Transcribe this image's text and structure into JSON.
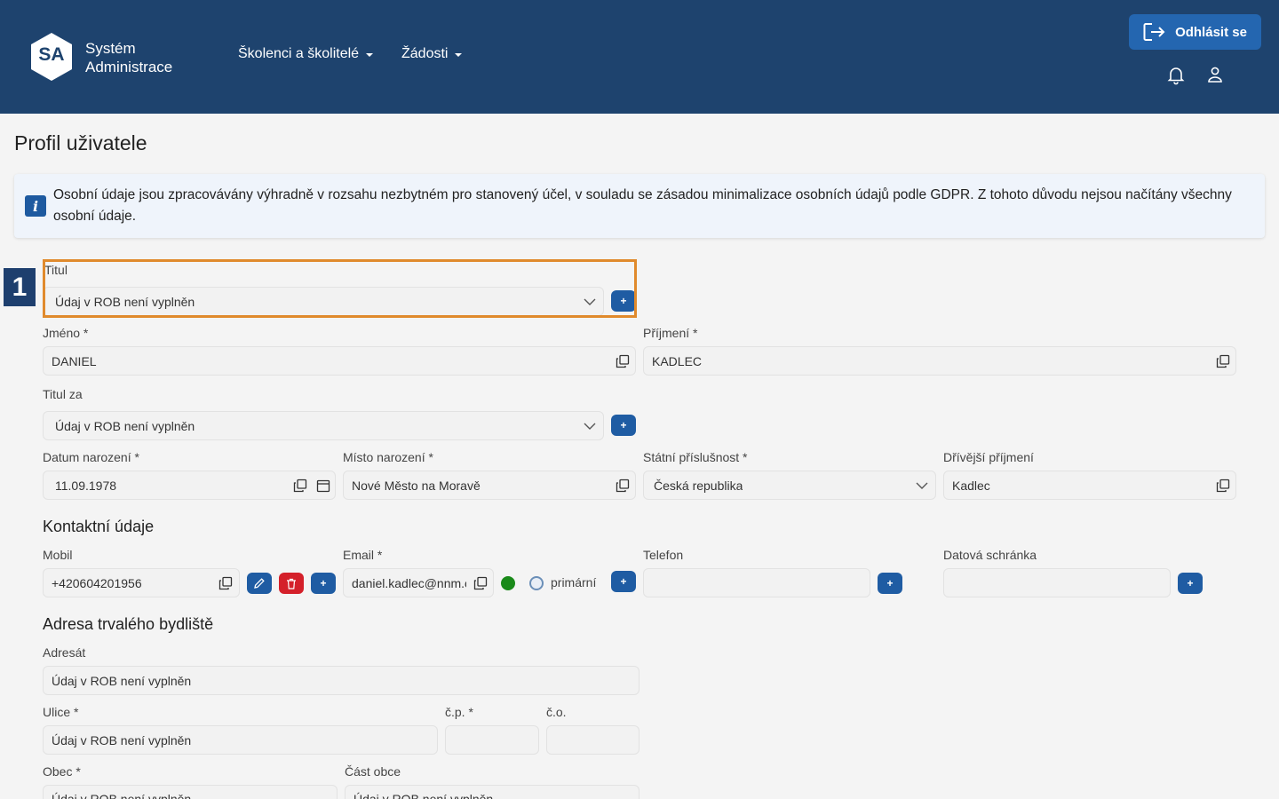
{
  "header": {
    "logo_abbr": "SA",
    "logo_line1": "Systém",
    "logo_line2": "Administrace",
    "nav": [
      {
        "label": "Školenci a školitelé"
      },
      {
        "label": "Žádosti"
      }
    ],
    "logout_label": "Odhlásit se"
  },
  "page": {
    "title": "Profil uživatele",
    "info_text": "Osobní údaje jsou zpracovávány výhradně v rozsahu nezbytném pro stanovený účel, v souladu se zásadou minimalizace osobních údajů podle GDPR. Z tohoto důvodu nejsou načítány všechny osobní údaje.",
    "info_icon": "i",
    "step_badge": "1"
  },
  "personal": {
    "titul_label": "Titul",
    "titul_value": "Údaj v ROB není vyplněn",
    "jmeno_label": "Jméno *",
    "jmeno_value": "DANIEL",
    "prijmeni_label": "Příjmení *",
    "prijmeni_value": "KADLEC",
    "titul_za_label": "Titul za",
    "titul_za_value": "Údaj v ROB není vyplněn",
    "datum_label": "Datum narození *",
    "datum_value": "11.09.1978",
    "misto_label": "Místo narození *",
    "misto_value": "Nové Město na Moravě",
    "statni_label": "Státní příslušnost *",
    "statni_value": "Česká republika",
    "drivejsi_label": "Dřívější příjmení",
    "drivejsi_value": "Kadlec"
  },
  "contact": {
    "section_title": "Kontaktní údaje",
    "mobil_label": "Mobil",
    "mobil_value": "+420604201956",
    "email_label": "Email *",
    "email_value": "daniel.kadlec@nnm.cz",
    "primary_label": "primární",
    "telefon_label": "Telefon",
    "telefon_value": "",
    "datova_label": "Datová schránka",
    "datova_value": "",
    "plus_symbol": "+"
  },
  "address": {
    "section_title": "Adresa trvalého bydliště",
    "adresat_label": "Adresát",
    "adresat_value": "Údaj v ROB není vyplněn",
    "ulice_label": "Ulice *",
    "ulice_value": "Údaj v ROB není vyplněn",
    "cp_label": "č.p. *",
    "co_label": "č.o.",
    "obec_label": "Obec *",
    "obec_value": "Údaj v ROB není vyplněn",
    "cast_label": "Část obce",
    "cast_value": "Údaj v ROB není vyplněn"
  },
  "colors": {
    "header_bg": "#1e436e",
    "accent": "#2466b0",
    "highlight": "#e08a2c",
    "danger": "#d4202a",
    "success": "#1a8a1a"
  }
}
